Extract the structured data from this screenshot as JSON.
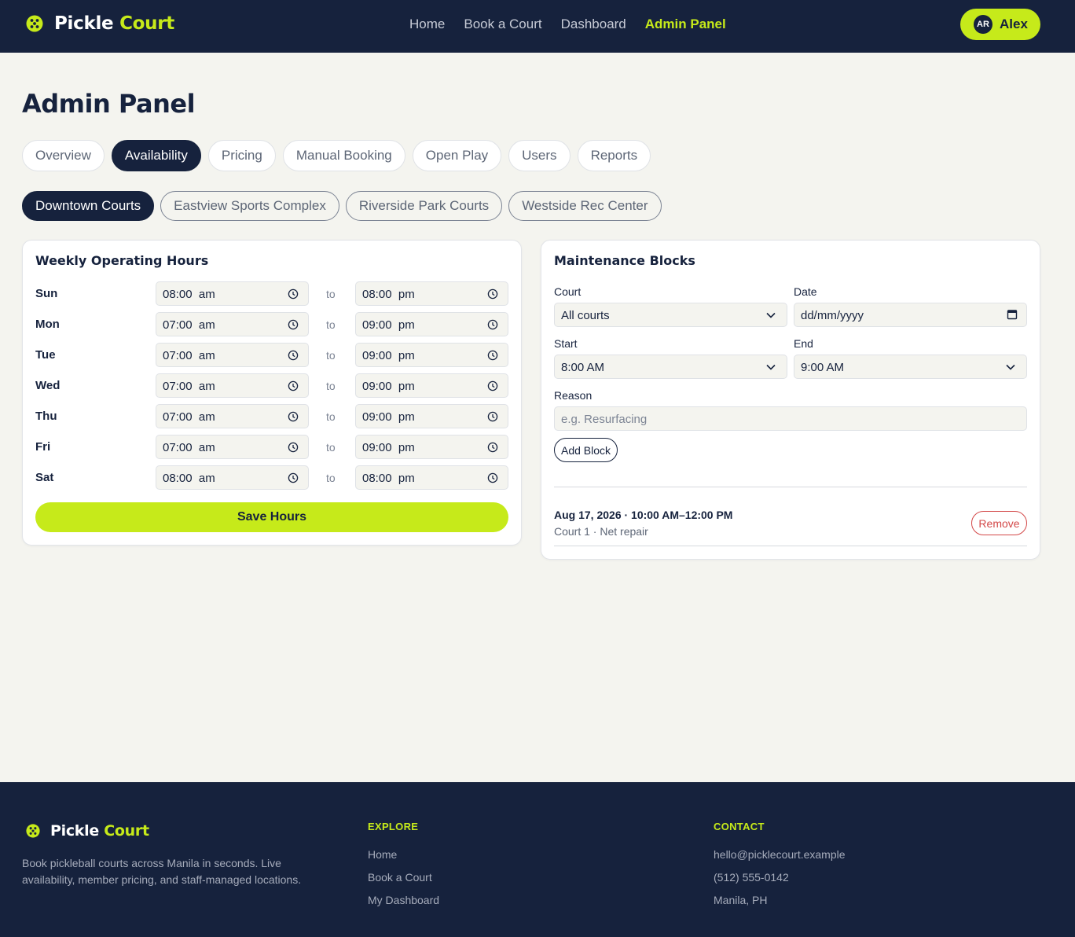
{
  "brand": {
    "name_first": "Pickle",
    "name_second": "Court",
    "logo_icon": "pickleball-icon"
  },
  "nav": {
    "links": [
      "Home",
      "Book a Court",
      "Dashboard",
      "Admin Panel"
    ],
    "active": "Admin Panel"
  },
  "user": {
    "initials": "AR",
    "name": "Alex"
  },
  "page": {
    "title": "Admin Panel"
  },
  "tabs": {
    "items": [
      "Overview",
      "Availability",
      "Pricing",
      "Manual Booking",
      "Open Play",
      "Users",
      "Reports"
    ],
    "active": "Availability"
  },
  "locations": {
    "items": [
      "Downtown Courts",
      "Eastview Sports Complex",
      "Riverside Park Courts",
      "Westside Rec Center"
    ],
    "active": "Downtown Courts"
  },
  "hours": {
    "title": "Weekly Operating Hours",
    "separator": "to",
    "days": [
      {
        "day": "Sun",
        "open": "08:00  am",
        "close": "08:00  pm"
      },
      {
        "day": "Mon",
        "open": "07:00  am",
        "close": "09:00  pm"
      },
      {
        "day": "Tue",
        "open": "07:00  am",
        "close": "09:00  pm"
      },
      {
        "day": "Wed",
        "open": "07:00  am",
        "close": "09:00  pm"
      },
      {
        "day": "Thu",
        "open": "07:00  am",
        "close": "09:00  pm"
      },
      {
        "day": "Fri",
        "open": "07:00  am",
        "close": "09:00  pm"
      },
      {
        "day": "Sat",
        "open": "08:00  am",
        "close": "08:00  pm"
      }
    ],
    "save_label": "Save Hours"
  },
  "maintenance": {
    "title": "Maintenance Blocks",
    "court_label": "Court",
    "court_value": "All courts",
    "date_label": "Date",
    "date_value": "dd/mm/yyyy",
    "start_label": "Start",
    "start_value": "8:00 AM",
    "end_label": "End",
    "end_value": "9:00 AM",
    "reason_label": "Reason",
    "reason_placeholder": "e.g. Resurfacing",
    "add_label": "Add Block",
    "blocks": [
      {
        "title": "Aug 17, 2026 · 10:00 AM–12:00 PM",
        "detail": "Court 1 · Net repair",
        "remove_label": "Remove"
      }
    ]
  },
  "footer": {
    "description": "Book pickleball courts across Manila in seconds. Live availability, member pricing, and staff-managed locations.",
    "explore_heading": "EXPLORE",
    "explore_links": [
      "Home",
      "Book a Court",
      "My Dashboard"
    ],
    "contact_heading": "CONTACT",
    "contact_items": [
      "hello@picklecourt.example",
      "(512) 555-0142",
      "Manila, PH"
    ]
  },
  "colors": {
    "navy": "#16223d",
    "accent": "#c6ea1a",
    "danger": "#d34848",
    "background": "#f4f4ef"
  }
}
